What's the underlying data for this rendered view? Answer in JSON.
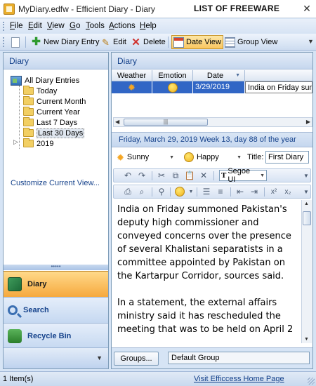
{
  "window": {
    "title": "MyDiary.edfw - Efficient Diary - Diary",
    "overlay_label": "LIST OF FREEWARE",
    "close_glyph": "✕"
  },
  "menu": {
    "items": [
      {
        "label": "File",
        "mnemonic": "F",
        "rest": "ile"
      },
      {
        "label": "Edit",
        "mnemonic": "E",
        "rest": "dit"
      },
      {
        "label": "View",
        "mnemonic": "V",
        "rest": "iew"
      },
      {
        "label": "Go",
        "mnemonic": "G",
        "rest": "o"
      },
      {
        "label": "Tools",
        "mnemonic": "T",
        "rest": "ools"
      },
      {
        "label": "Actions",
        "mnemonic": "A",
        "rest": "ctions"
      },
      {
        "label": "Help",
        "mnemonic": "H",
        "rest": "elp"
      }
    ]
  },
  "toolbar": {
    "new_entry": "New Diary Entry",
    "edit": "Edit",
    "delete": "Delete",
    "date_view": "Date View",
    "group_view": "Group View",
    "active_view": "Date View"
  },
  "sidebar": {
    "header": "Diary",
    "tree": {
      "root": "All Diary Entries",
      "items": [
        "Today",
        "Current Month",
        "Current Year",
        "Last 7 Days",
        "Last 30 Days",
        "2019"
      ],
      "selected": "Last 30 Days"
    },
    "customize_link": "Customize Current View...",
    "nav": [
      {
        "label": "Diary",
        "icon": "book-icon",
        "active": true
      },
      {
        "label": "Search",
        "icon": "search-icon",
        "active": false
      },
      {
        "label": "Recycle Bin",
        "icon": "recycle-bin-icon",
        "active": false
      }
    ]
  },
  "main": {
    "header": "Diary",
    "columns": [
      "Weather",
      "Emotion",
      "Date"
    ],
    "rows": [
      {
        "weather_icon": "sun-icon",
        "emotion_icon": "happy-face-icon",
        "date": "3/29/2019",
        "text": "India on Friday summoned"
      }
    ],
    "date_strip": "Friday, March 29, 2019   Week 13, day 88 of the year",
    "weather": "Sunny",
    "emotion": "Happy",
    "title_label": "Title:",
    "title_value": "First Diary",
    "font_name": "Segoe UI",
    "body": [
      "India on Friday summoned Pakistan's deputy high commissioner and conveyed concerns over the presence of several Khalistani separatists in a committee appointed by Pakistan on the Kartarpur Corridor, sources said.",
      "In a statement, the external affairs ministry said it has rescheduled the meeting that was to be held on April 2"
    ],
    "groups_button": "Groups...",
    "group_value": "Default Group"
  },
  "status": {
    "count": "1 Item(s)",
    "link": "Visit Efficcess Home Page"
  },
  "colors": {
    "accent": "#3166c5",
    "header_text": "#15428b",
    "active_nav": "#f6a93e"
  }
}
